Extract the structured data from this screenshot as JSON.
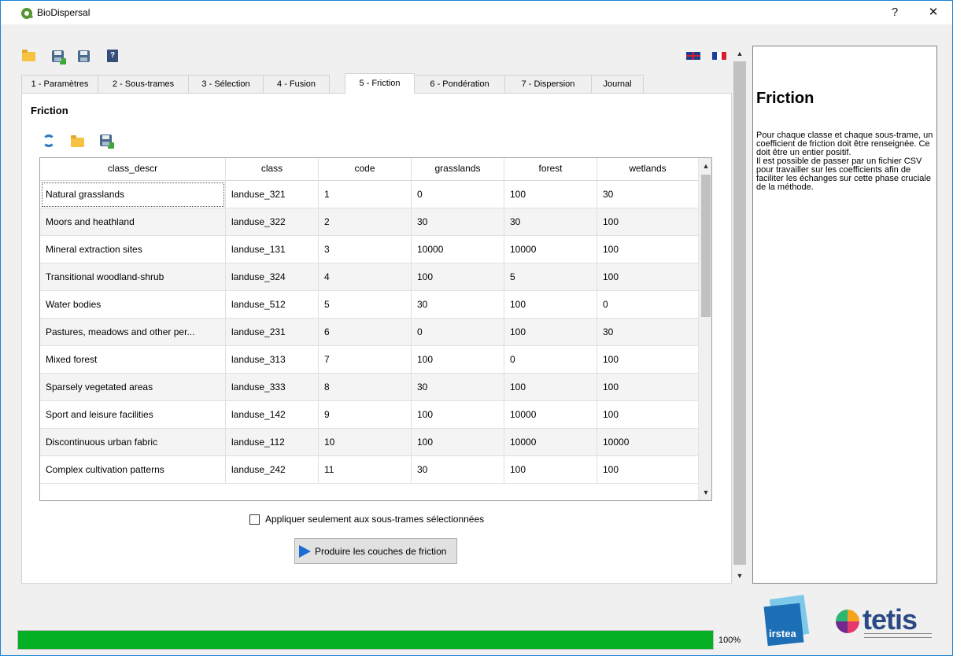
{
  "window": {
    "title": "BioDispersal",
    "help_btn": "?",
    "close_btn": "✕"
  },
  "tabs": [
    {
      "label": "1 - Paramètres"
    },
    {
      "label": "2 - Sous-trames"
    },
    {
      "label": "3 - Sélection"
    },
    {
      "label": "4 - Fusion"
    },
    {
      "label": "5 - Friction"
    },
    {
      "label": "6 - Pondération"
    },
    {
      "label": "7 - Dispersion"
    },
    {
      "label": "Journal"
    }
  ],
  "active_tab": "5 - Friction",
  "panel": {
    "title": "Friction"
  },
  "table": {
    "columns": [
      "class_descr",
      "class",
      "code",
      "grasslands",
      "forest",
      "wetlands"
    ],
    "rows": [
      [
        "Natural grasslands",
        "landuse_321",
        "1",
        "0",
        "100",
        "30"
      ],
      [
        "Moors and heathland",
        "landuse_322",
        "2",
        "30",
        "30",
        "100"
      ],
      [
        "Mineral extraction sites",
        "landuse_131",
        "3",
        "10000",
        "10000",
        "100"
      ],
      [
        "Transitional woodland-shrub",
        "landuse_324",
        "4",
        "100",
        "5",
        "100"
      ],
      [
        "Water bodies",
        "landuse_512",
        "5",
        "30",
        "100",
        "0"
      ],
      [
        "Pastures, meadows and other per...",
        "landuse_231",
        "6",
        "0",
        "100",
        "30"
      ],
      [
        "Mixed forest",
        "landuse_313",
        "7",
        "100",
        "0",
        "100"
      ],
      [
        "Sparsely vegetated areas",
        "landuse_333",
        "8",
        "30",
        "100",
        "100"
      ],
      [
        "Sport and leisure facilities",
        "landuse_142",
        "9",
        "100",
        "10000",
        "100"
      ],
      [
        "Discontinuous urban fabric",
        "landuse_112",
        "10",
        "100",
        "10000",
        "10000"
      ],
      [
        "Complex cultivation patterns",
        "landuse_242",
        "11",
        "30",
        "100",
        "100"
      ]
    ]
  },
  "checkbox": {
    "label": "Appliquer seulement aux sous-trames sélectionnées",
    "checked": false
  },
  "run_button": {
    "label": "Produire les couches de friction"
  },
  "help": {
    "title": "Friction",
    "paragraphs": [
      " Pour chaque classe et chaque sous-trame, un coefficient de friction doit être renseignée. Ce doit être un entier positif.",
      "Il est possible de passer par un fichier CSV pour travailler sur les coefficients afin de faciliter les échanges sur cette phase cruciale de la méthode."
    ]
  },
  "progress": {
    "value": 100,
    "text": "100%",
    "color": "#06b025"
  },
  "logos": {
    "irstea": "irstea",
    "tetis": "tetis"
  },
  "icons": {
    "toolbar": [
      "open-folder-icon",
      "save-as-icon",
      "save-icon",
      "help-book-icon"
    ],
    "table_toolbar": [
      "refresh-icon",
      "open-folder-icon",
      "save-as-icon"
    ],
    "languages": [
      "english-flag-icon",
      "french-flag-icon"
    ]
  }
}
